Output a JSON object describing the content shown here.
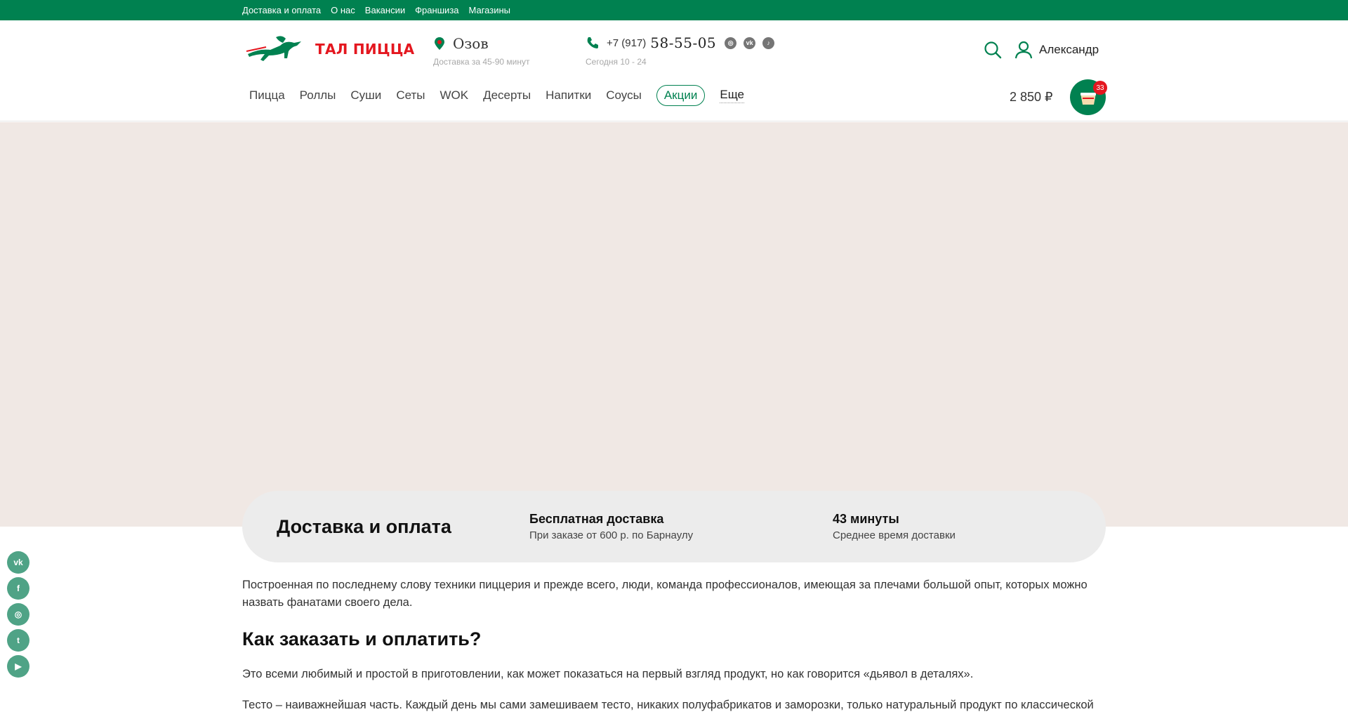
{
  "topbar": {
    "links": [
      "Доставка и оплата",
      "О нас",
      "Вакансии",
      "Франшиза",
      "Магазины"
    ]
  },
  "header": {
    "logo_text": "ТАЛ ПИЦЦА",
    "city": "Озов",
    "delivery_time": "Доставка за 45-90 минут",
    "phone_prefix": "+7 (917)",
    "phone_main": "58-55-05",
    "hours": "Сегодня 10 - 24",
    "user_name": "Александр",
    "icons": [
      "instagram-icon",
      "vk-icon",
      "tiktok-icon",
      "search-icon",
      "user-icon",
      "location-pin-icon",
      "phone-icon",
      "cart-icon"
    ]
  },
  "nav": {
    "items": [
      "Пицца",
      "Роллы",
      "Суши",
      "Сеты",
      "WOK",
      "Десерты",
      "Напитки",
      "Соусы",
      "Акции",
      "Еще"
    ]
  },
  "cart": {
    "total": "2 850 ₽",
    "count": "33"
  },
  "info": {
    "title": "Доставка и оплата",
    "free_delivery_title": "Бесплатная доставка",
    "free_delivery_sub": "При заказе от 600 р. по Барнаулу",
    "avg_time_title": "43 минуты",
    "avg_time_sub": "Среднее время доставки"
  },
  "content": {
    "intro": "Построенная по последнему слову техники пиццерия и прежде всего, люди, команда профессионалов, имеющая за плечами большой опыт, которых можно назвать фанатами своего дела.",
    "heading": "Как заказать и оплатить?",
    "p1": "Это всеми любимый и простой в приготовлении, как может показаться на первый взгляд продукт, но как говорится «дьявол в деталях».",
    "p2": "Тесто – наиважнейшая часть. Каждый день мы сами замешиваем тесто, никаких полуфабрикатов и заморозки, только натуральный продукт по классической технологии."
  },
  "side_social": [
    "vk-icon",
    "facebook-icon",
    "instagram-icon",
    "twitter-icon",
    "youtube-icon"
  ],
  "colors": {
    "brand_green": "#008150",
    "brand_red": "#e4171f",
    "banner_bg": "#f0e8e4",
    "card_bg": "#ececec"
  }
}
